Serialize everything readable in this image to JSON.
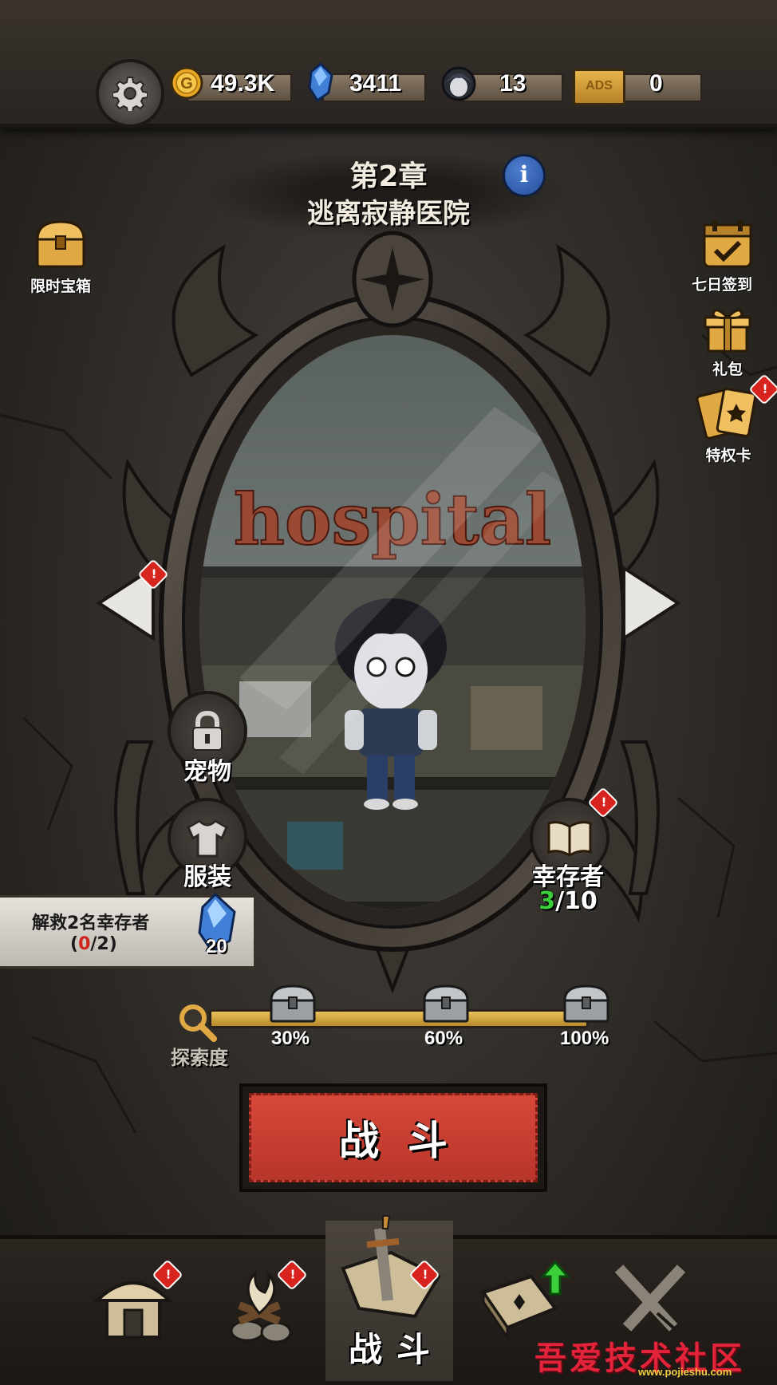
{
  "currencies": {
    "gold": "49.3K",
    "crystal": "3411",
    "survivor_count": "13",
    "ads": "0",
    "ads_label": "ADS"
  },
  "chapter": {
    "number": "第2章",
    "name": "逃离寂静医院",
    "sign_text": "hospital"
  },
  "left_side": {
    "chest_label": "限时宝箱"
  },
  "right_side": {
    "checkin_label": "七日签到",
    "gift_label": "礼包",
    "card_label": "特权卡"
  },
  "features": {
    "pet_label": "宠物",
    "outfit_label": "服装",
    "survivor_label": "幸存者",
    "survivor_progress_current": "3",
    "survivor_progress_total": "/10"
  },
  "rescue": {
    "title": "解救2名幸存者",
    "open_paren": "(",
    "progress_current": "0",
    "progress_total": "/2)",
    "reward": "20"
  },
  "exploration": {
    "label": "探索度",
    "milestones": [
      "30%",
      "60%",
      "100%"
    ]
  },
  "battle_button": "战斗",
  "bottom_nav": {
    "active_label": "战斗"
  },
  "watermark": {
    "text": "吾爱技术社区",
    "url": "www.pojieshu.com"
  },
  "colors": {
    "badge_red": "#d8241e",
    "battle_red": "#c63d30",
    "progress_gold": "#d6a840",
    "survivor_green": "#3ccf3c",
    "info_blue": "#2f5fb5"
  }
}
